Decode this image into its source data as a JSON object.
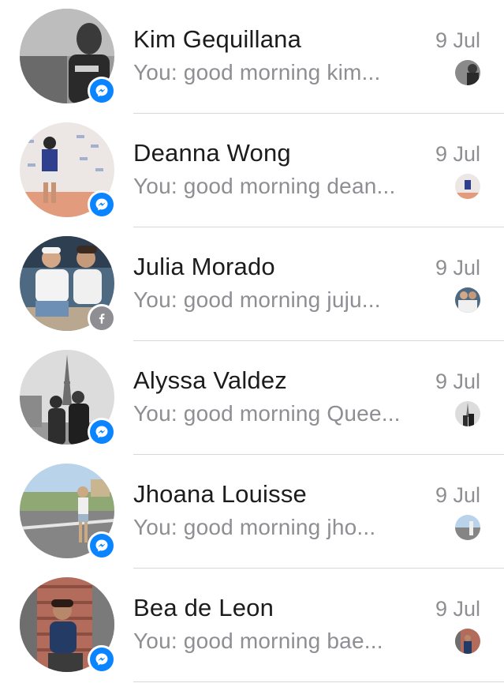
{
  "conversations": [
    {
      "name": "Kim Gequillana",
      "preview": "You: good morning kim...",
      "time": "9 Jul",
      "badge": "messenger-icon",
      "avatar_colors": [
        "#6a6a6a",
        "#bdbdbd",
        "#2a2a2a"
      ]
    },
    {
      "name": "Deanna Wong",
      "preview": "You: good morning dean...",
      "time": "9 Jul",
      "badge": "messenger-icon",
      "avatar_colors": [
        "#e8e2e0",
        "#e39b7d",
        "#2f3f8f"
      ]
    },
    {
      "name": "Julia Morado",
      "preview": "You: good morning juju...",
      "time": "9 Jul",
      "badge": "facebook-icon",
      "avatar_colors": [
        "#3a5570",
        "#f1f1f1",
        "#c49a7a"
      ]
    },
    {
      "name": "Alyssa Valdez",
      "preview": "You: good morning Quee...",
      "time": "9 Jul",
      "badge": "messenger-icon",
      "avatar_colors": [
        "#dcdcdc",
        "#8a8a8a",
        "#2e2e2e"
      ]
    },
    {
      "name": "Jhoana Louisse",
      "preview": "You: good morning jho...",
      "time": "9 Jul",
      "badge": "messenger-icon",
      "avatar_colors": [
        "#b9d3ea",
        "#858585",
        "#caa983"
      ]
    },
    {
      "name": "Bea de Leon",
      "preview": "You: good morning bae...",
      "time": "9 Jul",
      "badge": "messenger-icon",
      "avatar_colors": [
        "#b36b5b",
        "#6e6e6e",
        "#243b66"
      ]
    }
  ],
  "colors": {
    "messenger_blue": "#0a84ff",
    "facebook_gray": "#8e8e93",
    "name_text": "#1c1c1c",
    "secondary_text": "#8e8e93",
    "divider": "#d8d8dc"
  }
}
